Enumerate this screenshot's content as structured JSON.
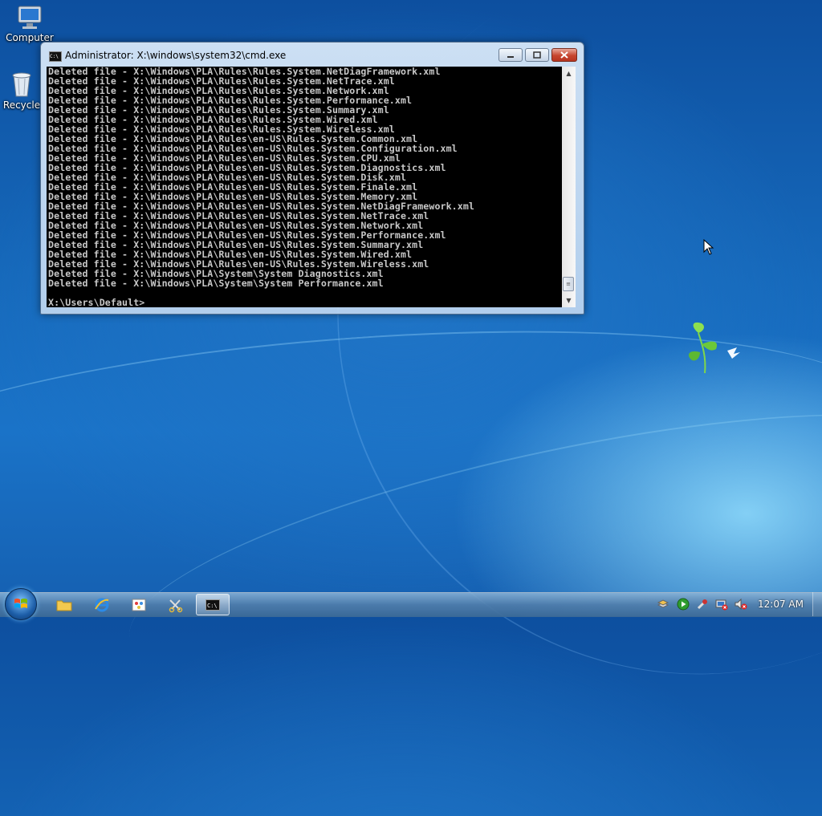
{
  "desktop": {
    "icons": [
      {
        "label": "Computer",
        "icon": "computer-icon"
      },
      {
        "label": "Recycle",
        "icon": "recycle-bin-icon"
      }
    ]
  },
  "window": {
    "title": "Administrator: X:\\windows\\system32\\cmd.exe",
    "icon": "cmd-icon",
    "buttons": {
      "minimize": "minimize-icon",
      "maximize": "maximize-icon",
      "close": "close-icon"
    },
    "console_lines": [
      "Deleted file - X:\\Windows\\PLA\\Rules\\Rules.System.NetDiagFramework.xml",
      "Deleted file - X:\\Windows\\PLA\\Rules\\Rules.System.NetTrace.xml",
      "Deleted file - X:\\Windows\\PLA\\Rules\\Rules.System.Network.xml",
      "Deleted file - X:\\Windows\\PLA\\Rules\\Rules.System.Performance.xml",
      "Deleted file - X:\\Windows\\PLA\\Rules\\Rules.System.Summary.xml",
      "Deleted file - X:\\Windows\\PLA\\Rules\\Rules.System.Wired.xml",
      "Deleted file - X:\\Windows\\PLA\\Rules\\Rules.System.Wireless.xml",
      "Deleted file - X:\\Windows\\PLA\\Rules\\en-US\\Rules.System.Common.xml",
      "Deleted file - X:\\Windows\\PLA\\Rules\\en-US\\Rules.System.Configuration.xml",
      "Deleted file - X:\\Windows\\PLA\\Rules\\en-US\\Rules.System.CPU.xml",
      "Deleted file - X:\\Windows\\PLA\\Rules\\en-US\\Rules.System.Diagnostics.xml",
      "Deleted file - X:\\Windows\\PLA\\Rules\\en-US\\Rules.System.Disk.xml",
      "Deleted file - X:\\Windows\\PLA\\Rules\\en-US\\Rules.System.Finale.xml",
      "Deleted file - X:\\Windows\\PLA\\Rules\\en-US\\Rules.System.Memory.xml",
      "Deleted file - X:\\Windows\\PLA\\Rules\\en-US\\Rules.System.NetDiagFramework.xml",
      "Deleted file - X:\\Windows\\PLA\\Rules\\en-US\\Rules.System.NetTrace.xml",
      "Deleted file - X:\\Windows\\PLA\\Rules\\en-US\\Rules.System.Network.xml",
      "Deleted file - X:\\Windows\\PLA\\Rules\\en-US\\Rules.System.Performance.xml",
      "Deleted file - X:\\Windows\\PLA\\Rules\\en-US\\Rules.System.Summary.xml",
      "Deleted file - X:\\Windows\\PLA\\Rules\\en-US\\Rules.System.Wired.xml",
      "Deleted file - X:\\Windows\\PLA\\Rules\\en-US\\Rules.System.Wireless.xml",
      "Deleted file - X:\\Windows\\PLA\\System\\System Diagnostics.xml",
      "Deleted file - X:\\Windows\\PLA\\System\\System Performance.xml",
      "",
      "X:\\Users\\Default>"
    ],
    "scrollbar": {
      "up": "scroll-up-icon",
      "down": "scroll-down-icon"
    }
  },
  "taskbar": {
    "start": "windows-start-icon",
    "pinned": [
      {
        "name": "explorer",
        "icon": "folder-icon"
      },
      {
        "name": "internet-explorer",
        "icon": "internet-explorer-icon"
      },
      {
        "name": "paint",
        "icon": "paint-icon"
      },
      {
        "name": "snipping",
        "icon": "snipping-icon"
      },
      {
        "name": "cmd",
        "icon": "cmd-icon",
        "active": true
      }
    ],
    "tray": [
      "layers-icon",
      "play-icon",
      "tools-icon",
      "network-icon",
      "volume-muted-icon"
    ],
    "clock": "12:07 AM"
  }
}
